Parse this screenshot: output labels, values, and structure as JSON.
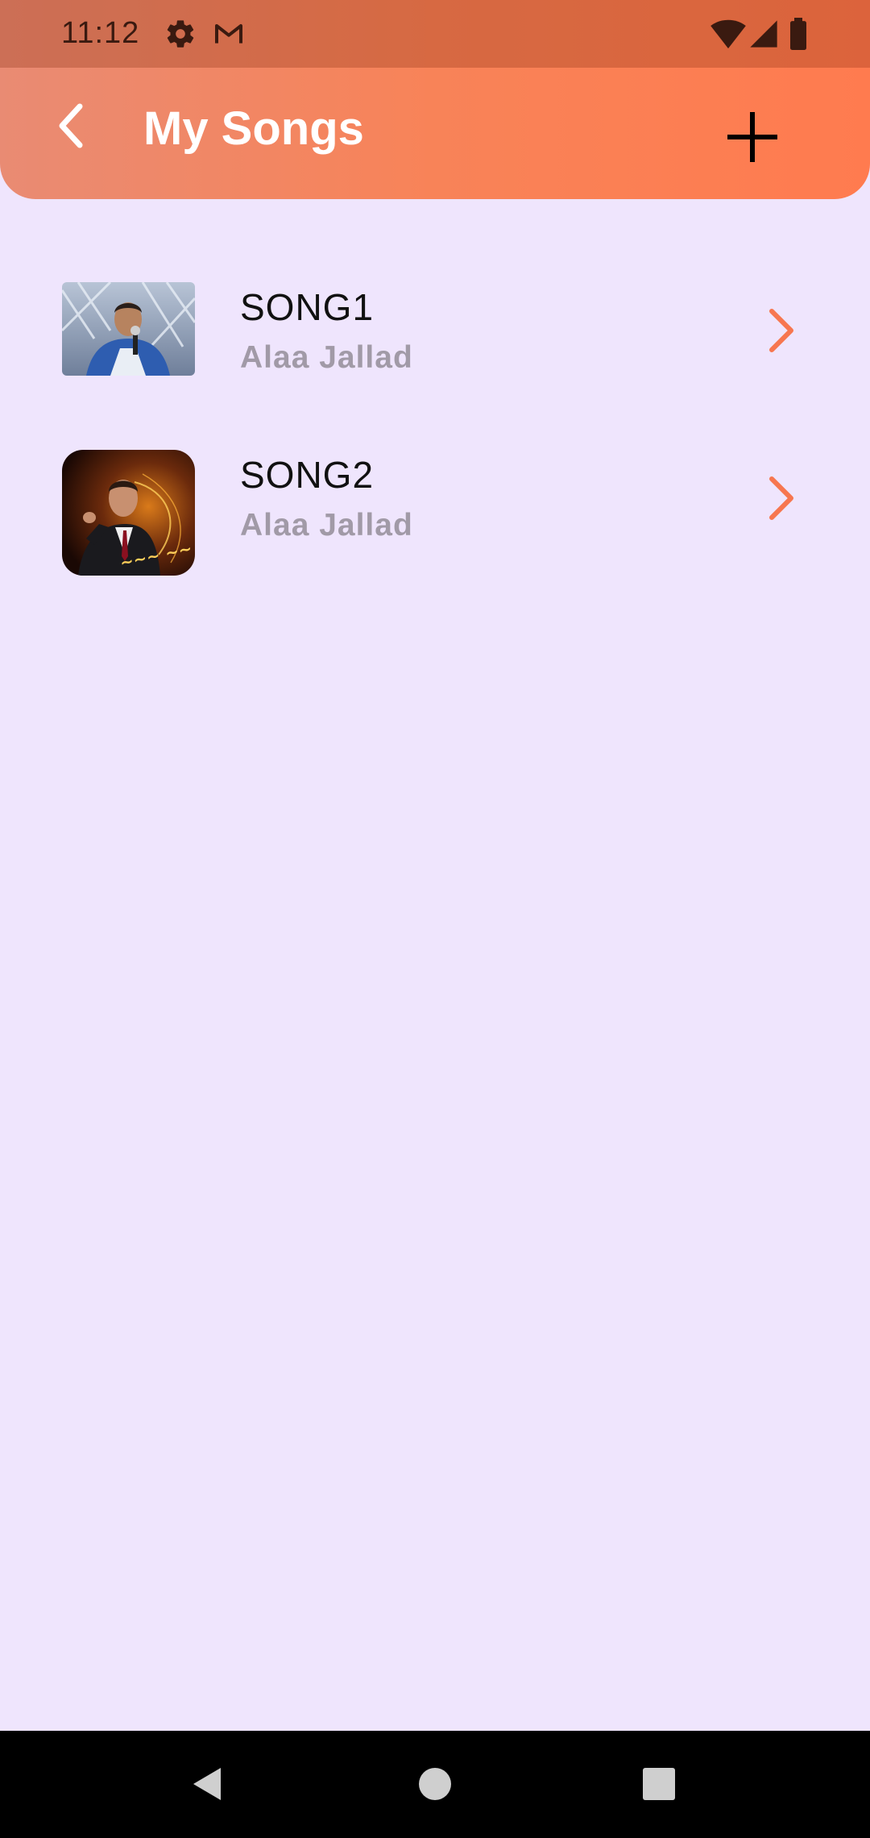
{
  "status_bar": {
    "time": "11:12",
    "icons_left": [
      "settings-icon",
      "gmail-icon"
    ],
    "icons_right": [
      "wifi-icon",
      "signal-icon",
      "battery-icon"
    ]
  },
  "header": {
    "title": "My Songs",
    "back_icon": "chevron-left-icon",
    "add_icon": "plus-icon",
    "gradient": [
      "#e98b73",
      "#ff7b4f"
    ]
  },
  "songs": [
    {
      "title": "SONG1",
      "artist": "Alaa Jallad",
      "thumbnail": "artist-photo-stage"
    },
    {
      "title": "SONG2",
      "artist": "Alaa Jallad",
      "thumbnail": "artist-photo-poster"
    }
  ],
  "navigation": {
    "buttons": [
      "back-triangle-icon",
      "home-circle-icon",
      "recents-square-icon"
    ]
  },
  "colors": {
    "background": "#efe5fd",
    "accent": "#ff7b4f",
    "chevron": "#f7764f",
    "artist_text": "#a19aa7"
  }
}
